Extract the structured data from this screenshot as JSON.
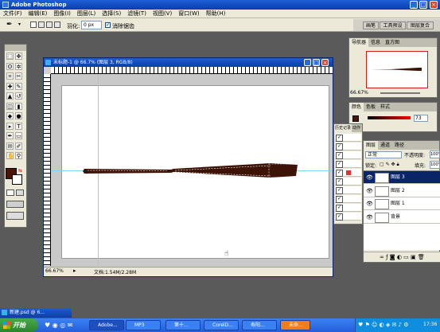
{
  "app": {
    "title": "Adobe Photoshop"
  },
  "menu": [
    "文件(F)",
    "编辑(E)",
    "图像(I)",
    "图层(L)",
    "选择(S)",
    "滤镜(T)",
    "视图(V)",
    "窗口(W)",
    "帮助(H)"
  ],
  "options": {
    "feather_label": "羽化:",
    "feather_value": "0 px",
    "antialias_label": "消除锯齿"
  },
  "right_tabs": [
    "画笔",
    "工具预设",
    "图层复合"
  ],
  "document": {
    "title": "未标题-1 @ 66.7% (图层 3, RGB/8)",
    "zoom": "66.67%",
    "doc_info": "文档:1.54M/2.28M"
  },
  "navigator": {
    "tabs": [
      "导航器",
      "信息",
      "直方图"
    ],
    "zoom": "66.67%"
  },
  "color_panel": {
    "tabs": [
      "颜色",
      "色板",
      "样式"
    ],
    "value": "73"
  },
  "history_panel": {
    "tabs": [
      "历史记录",
      "动作"
    ]
  },
  "layers_panel": {
    "tabs": [
      "图层",
      "通道",
      "路径"
    ],
    "blend_mode": "正常",
    "opacity_label": "不透明度:",
    "opacity_value": "100%",
    "lock_label": "锁定:",
    "fill_label": "填充:",
    "fill_value": "100%",
    "layers": [
      {
        "name": "图层 3",
        "selected": true
      },
      {
        "name": "图层 2",
        "selected": false
      },
      {
        "name": "图层 1",
        "selected": false
      },
      {
        "name": "背景",
        "selected": false
      }
    ]
  },
  "minimized_doc": {
    "title": "新建.psd @ 6..."
  },
  "taskbar": {
    "start": "开始",
    "items": [
      "Adobe...",
      "MP3",
      "第十...",
      "CorelD...",
      "寿阳...",
      "未命..."
    ],
    "clock": "17:36"
  },
  "colors": {
    "foreground": "#4a1408",
    "background": "#ffffff",
    "stick": "#3d1306",
    "guide": "#7ad8f0",
    "accent": "#0a246a"
  }
}
